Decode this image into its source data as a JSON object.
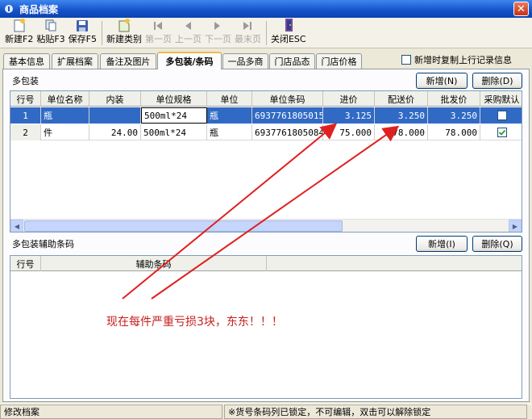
{
  "window": {
    "title": "商品档案"
  },
  "toolbar": {
    "new": "新建F2",
    "paste": "粘贴F3",
    "save": "保存F5",
    "new_category": "新建类别",
    "first": "第一页",
    "prev": "上一页",
    "next": "下一页",
    "last": "最末页",
    "close": "关闭ESC"
  },
  "tabs": [
    "基本信息",
    "扩展档案",
    "备注及图片",
    "多包装/条码",
    "一品多商",
    "门店品态",
    "门店价格"
  ],
  "copy_prev_label": "新增时复制上行记录信息",
  "multi_pack": {
    "title": "多包装",
    "add_label": "新增(N)",
    "delete_label": "删除(D)",
    "columns": [
      "行号",
      "单位名称",
      "内装",
      "单位规格",
      "单位",
      "单位条码",
      "进价",
      "配送价",
      "批发价",
      "采购默认"
    ],
    "rows": [
      {
        "no": "1",
        "unit_name": "瓶",
        "inner": "",
        "spec": "500ml*24",
        "unit": "瓶",
        "barcode": "6937761805015",
        "purchase": "3.125",
        "delivery": "3.250",
        "wholesale": "3.250",
        "default": false
      },
      {
        "no": "2",
        "unit_name": "件",
        "inner": "24.00",
        "spec": "500ml*24",
        "unit": "瓶",
        "barcode": "6937761805084",
        "purchase": "75.000",
        "delivery": "78.000",
        "wholesale": "78.000",
        "default": true
      }
    ]
  },
  "aux_barcode": {
    "title": "多包装辅助条码",
    "add_label": "新增(I)",
    "delete_label": "删除(Q)",
    "columns": [
      "行号",
      "辅助条码"
    ]
  },
  "annotation": "现在每件严重亏损3块，东东！！！",
  "status": {
    "left": "修改档案",
    "middle": "※货号条码列已锁定，不可编辑，双击可以解除锁定"
  },
  "colors": {
    "arrow": "#e02020",
    "selection": "#316ac5",
    "title_bar": "#1552c8"
  }
}
